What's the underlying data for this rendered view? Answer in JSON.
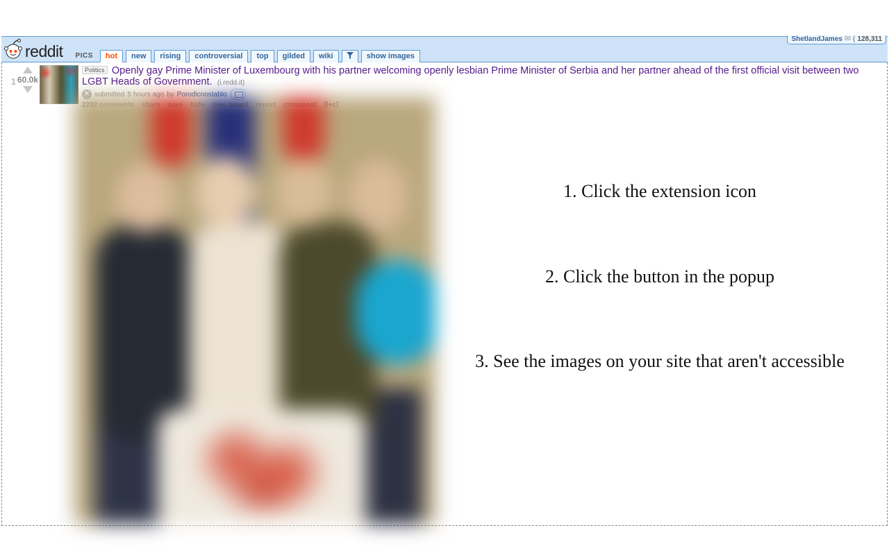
{
  "header": {
    "logo_text": "reddit",
    "subreddit_label": "PICS",
    "username": "ShetlandJames",
    "karma": "128,311"
  },
  "tabs": [
    "hot",
    "new",
    "rising",
    "controversial",
    "top",
    "gilded",
    "wiki",
    "show images"
  ],
  "post": {
    "rank": "1",
    "score": "60.0k",
    "flair": "Politics",
    "title": "Openly gay Prime Minister of Luxembourg with his partner welcoming openly lesbian Prime Minister of Serbia and her partner ahead of the first official visit between two LGBT Heads of Government.",
    "domain": "(i.redd.it)",
    "submitted_prefix": "submitted",
    "submitted_time": "5 hours ago",
    "submitted_by_word": "by",
    "author": "Porodicnostablo",
    "actions": {
      "comments": "2292 comments",
      "share": "share",
      "save": "save",
      "hide": "hide",
      "award": "give award",
      "report": "report",
      "crosspost": "crosspost",
      "shortcut": "[l+c]"
    }
  },
  "instructions": {
    "step1": "1. Click the extension icon",
    "step2": "2. Click the button in the popup",
    "step3": "3. See the images on your site that aren't accessible"
  }
}
